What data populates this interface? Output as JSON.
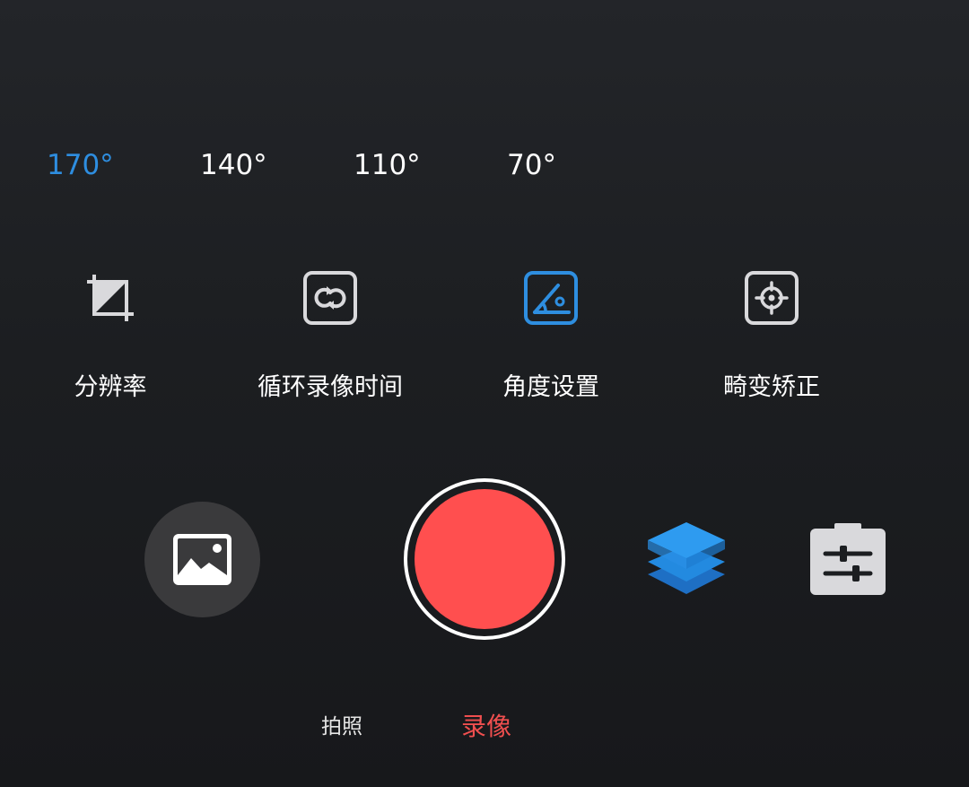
{
  "angle_options": [
    {
      "label": "170°",
      "active": true
    },
    {
      "label": "140°",
      "active": false
    },
    {
      "label": "110°",
      "active": false
    },
    {
      "label": "70°",
      "active": false
    }
  ],
  "settings": [
    {
      "label": "分辨率",
      "icon": "crop-icon"
    },
    {
      "label": "循环录像时间",
      "icon": "loop-icon"
    },
    {
      "label": "角度设置",
      "icon": "angle-icon"
    },
    {
      "label": "畸变矫正",
      "icon": "target-icon"
    }
  ],
  "controls": {
    "gallery_icon": "image-icon",
    "record_icon": "record-icon",
    "layers_icon": "layers-icon",
    "adjust_icon": "sliders-icon"
  },
  "modes": {
    "photo_label": "拍照",
    "video_label": "录像",
    "active": "video"
  },
  "colors": {
    "accent_blue": "#2e8ee0",
    "record_red": "#ff4f4f",
    "active_mode_red": "#f04f4f",
    "icon_gray": "#d9d9dc",
    "background": "#1c1e21"
  }
}
